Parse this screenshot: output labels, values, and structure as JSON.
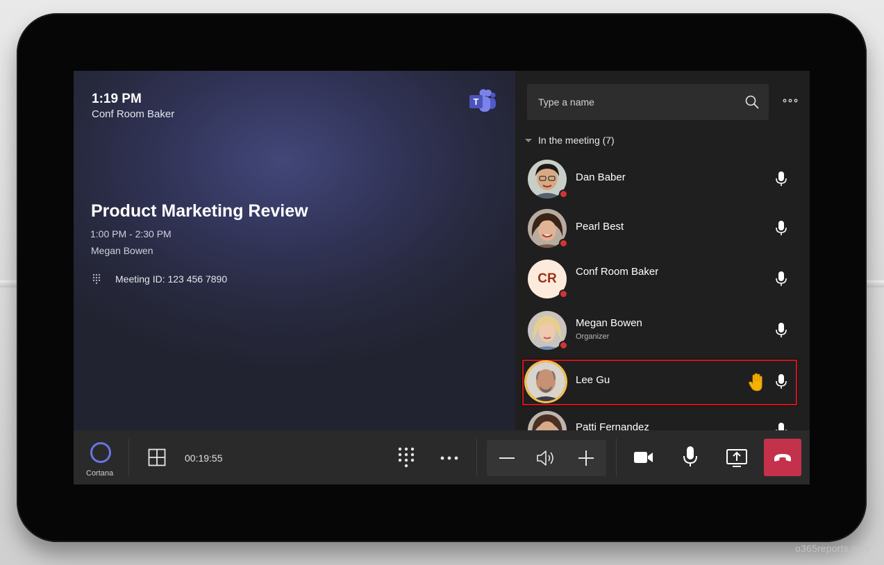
{
  "header": {
    "time": "1:19 PM",
    "room": "Conf Room Baker"
  },
  "meeting": {
    "title": "Product Marketing Review",
    "time_range": "1:00 PM - 2:30 PM",
    "organizer": "Megan Bowen",
    "meeting_id": "Meeting ID: 123 456 7890"
  },
  "search": {
    "placeholder": "Type a name"
  },
  "participants_section": {
    "label": "In the meeting (7)"
  },
  "participants": [
    {
      "name": "Dan Baber",
      "subtitle": "",
      "avatar": "photo"
    },
    {
      "name": "Pearl Best",
      "subtitle": "",
      "avatar": "photo"
    },
    {
      "name": "Conf Room Baker",
      "subtitle": "",
      "initials": "CR"
    },
    {
      "name": "Megan Bowen",
      "subtitle": "Organizer",
      "avatar": "photo"
    },
    {
      "name": "Lee Gu",
      "subtitle": "",
      "avatar": "photo",
      "hand_raised": true
    },
    {
      "name": "Patti Fernandez",
      "subtitle": "",
      "avatar": "photo"
    }
  ],
  "toolbar": {
    "cortana_label": "Cortana",
    "timer": "00:19:55"
  },
  "watermark": "o365reports.com",
  "colors": {
    "accent": "#6b74e6",
    "hangup": "#c4314b",
    "presence_busy": "#d13438",
    "highlight": "#d2141b",
    "hand": "#f7b000"
  },
  "icons": {
    "teams": "teams-logo-icon",
    "search": "search-icon",
    "more": "more-options-icon",
    "mic": "mic-icon",
    "hand": "raise-hand-icon",
    "layout": "layout-icon",
    "dialpad": "dialpad-icon",
    "volume_down": "minus-icon",
    "speaker": "speaker-icon",
    "volume_up": "plus-icon",
    "video": "video-camera-icon",
    "share": "share-screen-icon",
    "hangup": "hang-up-icon"
  }
}
